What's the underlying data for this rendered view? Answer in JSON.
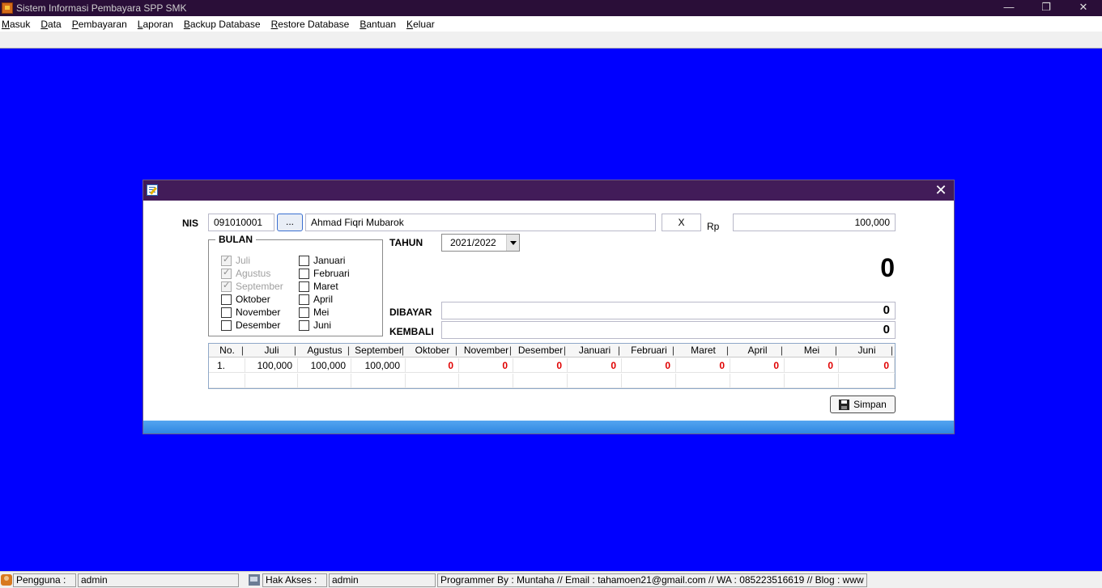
{
  "window": {
    "title": "Sistem Informasi Pembayara SPP SMK",
    "controls": {
      "minimize": "—",
      "restore": "❐",
      "close": "✕"
    }
  },
  "menu": {
    "items": [
      {
        "mnemonic": "M",
        "rest": "asuk"
      },
      {
        "mnemonic": "D",
        "rest": "ata"
      },
      {
        "mnemonic": "P",
        "rest": "embayaran"
      },
      {
        "mnemonic": "L",
        "rest": "aporan"
      },
      {
        "mnemonic": "B",
        "rest": "ackup Database"
      },
      {
        "mnemonic": "R",
        "rest": "estore Database"
      },
      {
        "mnemonic": "B",
        "rest": "antuan"
      },
      {
        "mnemonic": "K",
        "rest": "eluar"
      }
    ]
  },
  "dialog": {
    "close_glyph": "✕",
    "nis_label": "NIS",
    "nis_value": "091010001",
    "browse_label": "...",
    "student_name": "Ahmad Fiqri Mubarok",
    "class_value": "X",
    "rp_label": "Rp",
    "fee_value": "100,000",
    "bulan_label": "BULAN",
    "months_left": [
      {
        "label": "Juli",
        "checked": true,
        "disabled": true
      },
      {
        "label": "Agustus",
        "checked": true,
        "disabled": true
      },
      {
        "label": "September",
        "checked": true,
        "disabled": true
      },
      {
        "label": "Oktober",
        "checked": false,
        "disabled": false
      },
      {
        "label": "November",
        "checked": false,
        "disabled": false
      },
      {
        "label": "Desember",
        "checked": false,
        "disabled": false
      }
    ],
    "months_right": [
      {
        "label": "Januari",
        "checked": false,
        "disabled": false
      },
      {
        "label": "Februari",
        "checked": false,
        "disabled": false
      },
      {
        "label": "Maret",
        "checked": false,
        "disabled": false
      },
      {
        "label": "April",
        "checked": false,
        "disabled": false
      },
      {
        "label": "Mei",
        "checked": false,
        "disabled": false
      },
      {
        "label": "Juni",
        "checked": false,
        "disabled": false
      }
    ],
    "tahun_label": "TAHUN",
    "tahun_value": "2021/2022",
    "total_value": "0",
    "dibayar_label": "DIBAYAR",
    "dibayar_value": "0",
    "kembali_label": "KEMBALI",
    "kembali_value": "0",
    "table": {
      "columns": [
        "No.",
        "Juli",
        "Agustus",
        "September",
        "Oktober",
        "November",
        "Desember",
        "Januari",
        "Februari",
        "Maret",
        "April",
        "Mei",
        "Juni"
      ],
      "rows": [
        [
          "1.",
          "100,000",
          "100,000",
          "100,000",
          "0",
          "0",
          "0",
          "0",
          "0",
          "0",
          "0",
          "0",
          "0"
        ]
      ]
    },
    "save_label": "Simpan"
  },
  "status": {
    "pengguna_label": "Pengguna :",
    "pengguna_value": "admin",
    "hak_akses_label": "Hak Akses :",
    "hak_akses_value": "admin",
    "credits": "Programmer By : Muntaha // Email : tahamoen21@gmail.com // WA : 085223516619 //  Blog : www"
  },
  "colors": {
    "desktop": "#0000ff",
    "titlebar": "#2a0e38",
    "dialog_titlebar": "#421c59",
    "unpaid_red": "#e00000"
  }
}
